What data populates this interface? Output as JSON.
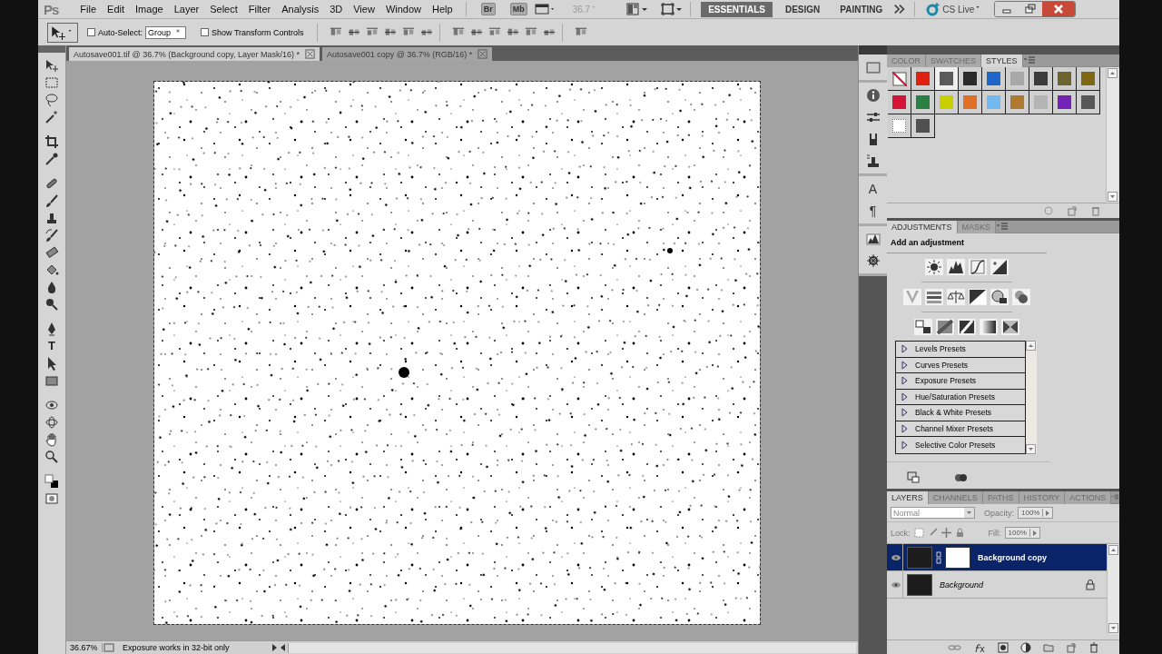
{
  "app": {
    "logo": "Ps",
    "bridge": "Br",
    "mini_bridge": "Mb",
    "zoom": "36.7",
    "cs_live": "CS Live"
  },
  "menu": [
    "File",
    "Edit",
    "Image",
    "Layer",
    "Select",
    "Filter",
    "Analysis",
    "3D",
    "View",
    "Window",
    "Help"
  ],
  "workspaces": [
    {
      "label": "ESSENTIALS",
      "selected": true
    },
    {
      "label": "DESIGN",
      "selected": false
    },
    {
      "label": "PAINTING",
      "selected": false
    }
  ],
  "options": {
    "auto_select": {
      "label": "Auto-Select:",
      "checked": false
    },
    "auto_select_target": "Group",
    "transform_controls": {
      "label": "Show Transform Controls",
      "checked": false
    }
  },
  "tools": {
    "type_tool": "T"
  },
  "documents": [
    {
      "title": "Autosave001.tif @ 36.7% (Background copy, Layer Mask/16) *",
      "selected": true
    },
    {
      "title": "Autosave001 copy @ 36.7% (RGB/16) *",
      "selected": false
    }
  ],
  "status_bar": {
    "zoom": "36.67%",
    "message": "Exposure works in 32-bit only"
  },
  "dock": {
    "character": "A",
    "paragraph": "¶"
  },
  "styles_panel": {
    "tabs": [
      {
        "label": "COLOR",
        "selected": false
      },
      {
        "label": "SWATCHES",
        "selected": false
      },
      {
        "label": "STYLES",
        "selected": true
      }
    ],
    "styles": [
      {
        "kind": "none",
        "color": "#ffffff",
        "selected": false
      },
      {
        "kind": "swatch",
        "color": "#e02010",
        "selected": false
      },
      {
        "kind": "swatch",
        "color": "#5a5a5a",
        "selected": true
      },
      {
        "kind": "swatch",
        "color": "#2a2a2a",
        "selected": false
      },
      {
        "kind": "swatch",
        "color": "#2066c8",
        "selected": false
      },
      {
        "kind": "swatch",
        "color": "#a8a8a8",
        "selected": false
      },
      {
        "kind": "swatch",
        "color": "#3c3c3c",
        "selected": false
      },
      {
        "kind": "swatch",
        "color": "#6e6430",
        "selected": false
      },
      {
        "kind": "swatch",
        "color": "#7e6814",
        "selected": false
      },
      {
        "kind": "swatch",
        "color": "#d41434",
        "selected": false
      },
      {
        "kind": "swatch",
        "color": "#2a8040",
        "selected": false
      },
      {
        "kind": "swatch",
        "color": "#c8d000",
        "selected": false
      },
      {
        "kind": "swatch",
        "color": "#e07028",
        "selected": false
      },
      {
        "kind": "swatch",
        "color": "#74b8f0",
        "selected": false
      },
      {
        "kind": "swatch",
        "color": "#b07830",
        "selected": false
      },
      {
        "kind": "swatch",
        "color": "#b4b4b4",
        "selected": false
      },
      {
        "kind": "swatch",
        "color": "#7424b4",
        "selected": false
      },
      {
        "kind": "swatch",
        "color": "#585858",
        "selected": false
      },
      {
        "kind": "outline",
        "color": "#ffffff",
        "selected": false
      },
      {
        "kind": "swatch",
        "color": "#505050",
        "selected": false
      }
    ]
  },
  "adjustments_panel": {
    "tabs": [
      {
        "label": "ADJUSTMENTS",
        "selected": true
      },
      {
        "label": "MASKS",
        "selected": false
      }
    ],
    "heading": "Add an adjustment",
    "presets": [
      {
        "label": "Levels Presets",
        "expanded": false
      },
      {
        "label": "Curves Presets",
        "expanded": false
      },
      {
        "label": "Exposure Presets",
        "expanded": false
      },
      {
        "label": "Hue/Saturation Presets",
        "expanded": false
      },
      {
        "label": "Black & White Presets",
        "expanded": false
      },
      {
        "label": "Channel Mixer Presets",
        "expanded": false
      },
      {
        "label": "Selective Color Presets",
        "expanded": false
      }
    ]
  },
  "layers_panel": {
    "tabs": [
      {
        "label": "LAYERS",
        "selected": true
      },
      {
        "label": "CHANNELS",
        "selected": false
      },
      {
        "label": "PATHS",
        "selected": false
      },
      {
        "label": "HISTORY",
        "selected": false
      },
      {
        "label": "ACTIONS",
        "selected": false
      }
    ],
    "blend_mode": "Normal",
    "opacity_label": "Opacity:",
    "opacity": "100%",
    "lock_label": "Lock:",
    "fill_label": "Fill:",
    "fill": "100%",
    "layers": [
      {
        "name": "Background copy",
        "selected": true,
        "visible": true,
        "mask": true,
        "locked": false
      },
      {
        "name": "Background",
        "selected": false,
        "visible": true,
        "mask": false,
        "locked": true
      }
    ]
  }
}
